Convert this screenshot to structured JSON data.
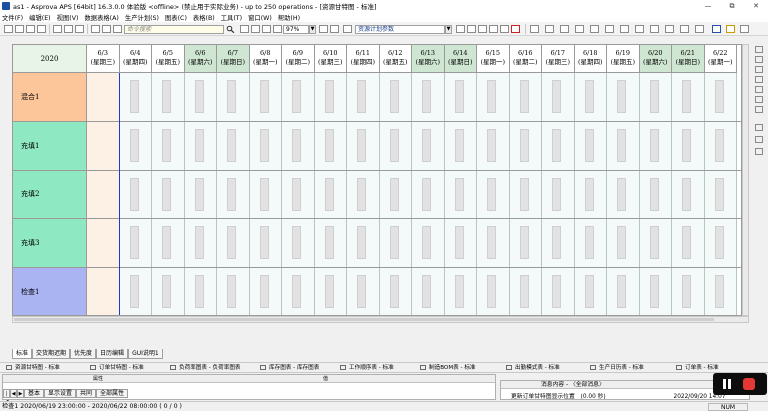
{
  "window": {
    "title": "as1 - Asprova APS [64bit] 16.3.0.0 体验版 <offline> (禁止用于实际业务) - up to 250 operations - [资源甘特图 - 标准]",
    "controls": [
      "—",
      "⧉",
      "✕"
    ]
  },
  "menu": [
    "文件(F)",
    "编辑(E)",
    "视图(V)",
    "数据表格(A)",
    "生产计划(S)",
    "图表(C)",
    "表格(B)",
    "工具(T)",
    "窗口(W)",
    "帮助(H)"
  ],
  "toolbar": {
    "search_placeholder": "命令搜索",
    "zoom": "97%",
    "param_set": "资源计划参数"
  },
  "gantt": {
    "year": "2020",
    "dates": [
      {
        "date": "6/3",
        "day": "(星期三)",
        "weekend": false
      },
      {
        "date": "6/4",
        "day": "(星期四)",
        "weekend": false
      },
      {
        "date": "6/5",
        "day": "(星期五)",
        "weekend": false
      },
      {
        "date": "6/6",
        "day": "(星期六)",
        "weekend": true
      },
      {
        "date": "6/7",
        "day": "(星期日)",
        "weekend": true
      },
      {
        "date": "6/8",
        "day": "(星期一)",
        "weekend": false
      },
      {
        "date": "6/9",
        "day": "(星期二)",
        "weekend": false
      },
      {
        "date": "6/10",
        "day": "(星期三)",
        "weekend": false
      },
      {
        "date": "6/11",
        "day": "(星期四)",
        "weekend": false
      },
      {
        "date": "6/12",
        "day": "(星期五)",
        "weekend": false
      },
      {
        "date": "6/13",
        "day": "(星期六)",
        "weekend": true
      },
      {
        "date": "6/14",
        "day": "(星期日)",
        "weekend": true
      },
      {
        "date": "6/15",
        "day": "(星期一)",
        "weekend": false
      },
      {
        "date": "6/16",
        "day": "(星期二)",
        "weekend": false
      },
      {
        "date": "6/17",
        "day": "(星期三)",
        "weekend": false
      },
      {
        "date": "6/18",
        "day": "(星期四)",
        "weekend": false
      },
      {
        "date": "6/19",
        "day": "(星期五)",
        "weekend": false
      },
      {
        "date": "6/20",
        "day": "(星期六)",
        "weekend": true
      },
      {
        "date": "6/21",
        "day": "(星期日)",
        "weekend": true
      },
      {
        "date": "6/22",
        "day": "(星期一)",
        "weekend": false
      }
    ],
    "resources": [
      {
        "name": "混合1",
        "color": "#fcc59a"
      },
      {
        "name": "充填1",
        "color": "#8ee8c2"
      },
      {
        "name": "充填2",
        "color": "#8ee8c2"
      },
      {
        "name": "充填3",
        "color": "#8ee8c2"
      },
      {
        "name": "检查1",
        "color": "#aab4f2"
      }
    ]
  },
  "sheet_tabs": [
    "标准",
    "交货期迟期",
    "优先度",
    "日历编辑",
    "GUI说明1"
  ],
  "window_tabs": [
    "资源甘特图 - 标准",
    "订单甘特图 - 标准",
    "负荷率图表 - 负荷率图表",
    "库存图表 - 库存图表",
    "工作顺序表 - 标准",
    "制造BOM表 - 标准",
    "出勤模式表 - 标准",
    "生产日历表 - 标准",
    "订单表 - 标准"
  ],
  "bottom_left": {
    "header_cols": [
      "属性",
      "值"
    ],
    "tabs": [
      "基本",
      "显示设置",
      "共同",
      "全部属性"
    ]
  },
  "messages": {
    "header": "消息内容 - 〈全部消息〉",
    "row_text": "更新订单甘特图显示位置",
    "row_detail": "(0.00 秒)",
    "row_time": "2022/09/20 14:07"
  },
  "status": {
    "text": "检查1 2020/06/19 23:00:00 - 2020/06/22 08:00:00 ( 0 / 0 )",
    "num": "NUM"
  }
}
